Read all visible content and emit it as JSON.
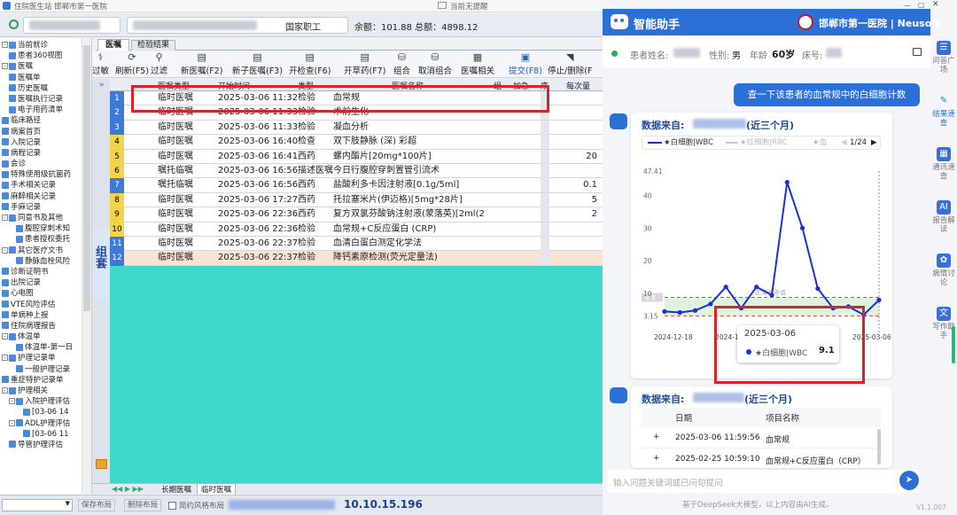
{
  "app": {
    "title": "住院医生站 邯郸市第一医院",
    "center_title": "当前无提醒"
  },
  "patient_bar": {
    "insurance": "国家职工",
    "balance": "余额：101.88 总额：4898.12"
  },
  "tabs": [
    {
      "label": "医嘱"
    },
    {
      "label": "检验结果"
    }
  ],
  "toolbar": [
    {
      "label": "过敏",
      "icon": "allergy"
    },
    {
      "label": "刷新(F5)",
      "icon": "refresh"
    },
    {
      "label": "过滤",
      "icon": "filter"
    },
    {
      "label": "新医嘱(F2)",
      "icon": "new"
    },
    {
      "label": "新子医嘱(F3)",
      "icon": "new-child"
    },
    {
      "label": "开检查(F6)",
      "icon": "exam"
    },
    {
      "label": "开草药(F7)",
      "icon": "herb"
    },
    {
      "label": "组合",
      "icon": "group"
    },
    {
      "label": "取消组合",
      "icon": "ungroup"
    },
    {
      "label": "医嘱相关",
      "icon": "related"
    },
    {
      "label": "提交(F8)",
      "icon": "save"
    },
    {
      "label": "停止/删除(F",
      "icon": "stop"
    }
  ],
  "tree": [
    {
      "label": "当前就诊",
      "level": 0,
      "expand": "-"
    },
    {
      "label": "患者360视图",
      "level": 1
    },
    {
      "label": "医嘱",
      "level": 0,
      "expand": "-"
    },
    {
      "label": "医嘱单",
      "level": 1
    },
    {
      "label": "历史医嘱",
      "level": 1
    },
    {
      "label": "医嘱执行记录",
      "level": 1
    },
    {
      "label": "电子用药清单",
      "level": 1
    },
    {
      "label": "临床路径",
      "level": 0
    },
    {
      "label": "病案首页",
      "level": 0
    },
    {
      "label": "入院记录",
      "level": 0
    },
    {
      "label": "病程记录",
      "level": 0
    },
    {
      "label": "会诊",
      "level": 0
    },
    {
      "label": "特殊使用级抗菌药",
      "level": 0
    },
    {
      "label": "手术相关记录",
      "level": 0
    },
    {
      "label": "麻醉相关记录",
      "level": 0
    },
    {
      "label": "手麻记录",
      "level": 0
    },
    {
      "label": "同意书及其他",
      "level": 0,
      "expand": "-"
    },
    {
      "label": "腹腔穿刺术知",
      "level": 2
    },
    {
      "label": "患者授权委托",
      "level": 2
    },
    {
      "label": "其它医疗文书",
      "level": 0,
      "expand": "-"
    },
    {
      "label": "静脉血栓风险",
      "level": 2
    },
    {
      "label": "诊断证明书",
      "level": 0
    },
    {
      "label": "出院记录",
      "level": 0
    },
    {
      "label": "心电图",
      "level": 0
    },
    {
      "label": "VTE风险评估",
      "level": 0
    },
    {
      "label": "单病种上报",
      "level": 0
    },
    {
      "label": "住院病理报告",
      "level": 0
    },
    {
      "label": "体温单",
      "level": 0,
      "expand": "-"
    },
    {
      "label": "体温单-第一日",
      "level": 2
    },
    {
      "label": "护理记录单",
      "level": 0,
      "expand": "-"
    },
    {
      "label": "一般护理记录",
      "level": 2
    },
    {
      "label": "重症特护记录单",
      "level": 0
    },
    {
      "label": "护理相关",
      "level": 0,
      "expand": "-"
    },
    {
      "label": "入院护理评估",
      "level": 1,
      "expand": "-"
    },
    {
      "label": "[03-06 14",
      "level": 3
    },
    {
      "label": "ADL护理评估",
      "level": 1,
      "expand": "-"
    },
    {
      "label": "[03-06 11",
      "level": 3
    },
    {
      "label": "导管护理评估",
      "level": 1
    }
  ],
  "grid": {
    "headers": [
      "医嘱类型",
      "开始时间",
      "类型",
      "医嘱名称",
      "组",
      "加急",
      "序",
      "每次量"
    ],
    "group_label": "组套",
    "rows": [
      {
        "no": "1",
        "type": "临时医嘱",
        "time": "2025-03-06 11:32",
        "cat": "检验",
        "name": "血常规",
        "dose": "",
        "urgent": false
      },
      {
        "no": "2",
        "type": "临时医嘱",
        "time": "2025-03-06 11:33",
        "cat": "检验",
        "name": "术前生化",
        "dose": "",
        "urgent": false
      },
      {
        "no": "3",
        "type": "临时医嘱",
        "time": "2025-03-06 11:33",
        "cat": "检验",
        "name": "凝血分析",
        "dose": "",
        "urgent": false
      },
      {
        "no": "4",
        "type": "临时医嘱",
        "time": "2025-03-06 16:40",
        "cat": "检查",
        "name": "双下肢静脉 (深) 彩超",
        "dose": "",
        "urgent": false
      },
      {
        "no": "5",
        "type": "临时医嘱",
        "time": "2025-03-06 16:41",
        "cat": "西药",
        "name": "螺内酯片[20mg*100片]",
        "dose": "20",
        "urgent": false
      },
      {
        "no": "6",
        "type": "嘱托临嘱",
        "time": "2025-03-06 16:56",
        "cat": "描述医嘱",
        "name": "今日行腹腔穿刺置管引流术",
        "dose": "",
        "urgent": false
      },
      {
        "no": "7",
        "type": "嘱托临嘱",
        "time": "2025-03-06 16:56",
        "cat": "西药",
        "name": "盐酸利多卡因注射液[0.1g/5ml]",
        "dose": "0.1",
        "urgent": false
      },
      {
        "no": "8",
        "type": "临时医嘱",
        "time": "2025-03-06 17:27",
        "cat": "西药",
        "name": "托拉塞米片(伊迈格)[5mg*28片]",
        "dose": "5",
        "urgent": false
      },
      {
        "no": "9",
        "type": "临时医嘱",
        "time": "2025-03-06 22:36",
        "cat": "西药",
        "name": "复方双氯芬酸钠注射液(蒙落英)[2ml(2",
        "dose": "2",
        "urgent": false
      },
      {
        "no": "10",
        "type": "临时医嘱",
        "time": "2025-03-06 22:36",
        "cat": "检验",
        "name": "血常规+C反应蛋白 (CRP)",
        "dose": "",
        "urgent": true
      },
      {
        "no": "11",
        "type": "临时医嘱",
        "time": "2025-03-06 22:37",
        "cat": "检验",
        "name": "血清白蛋白测定化学法",
        "dose": "",
        "urgent": true
      },
      {
        "no": "12",
        "type": "临时医嘱",
        "time": "2025-03-06 22:37",
        "cat": "检验",
        "name": "降钙素原检测(荧光定量法)",
        "dose": "",
        "urgent": true
      }
    ]
  },
  "bottom_tabs": [
    {
      "label": "长期医嘱"
    },
    {
      "label": "临时医嘱"
    }
  ],
  "status": {
    "save_layout": "保存布局",
    "delete_layout": "删除布局",
    "risk_layout": "简约风格布局",
    "ip": "10.10.15.196"
  },
  "assistant": {
    "title": "智能助手",
    "hospital": "邯郸市第一医院 | Neusoft",
    "patient_label": "患者姓名:",
    "gender_label": "性别:",
    "gender": "男",
    "age_label": "年龄",
    "age": "60岁",
    "bed_label": "床号:",
    "user_msg": "查一下该患者的血常规中的白细胞计数",
    "card1_prefix": "数据来自:",
    "card1_suffix": "(近三个月)",
    "legend": {
      "active": "★白细胞|WBC",
      "second": "★红细胞|RBC",
      "third": "★血",
      "page": "1/24"
    },
    "card2_prefix": "数据来自:",
    "card2_suffix": "(近三个月)",
    "table_headers": [
      "日期",
      "项目名称"
    ],
    "table_rows": [
      {
        "date": "2025-03-06 11:59:56",
        "item": "血常规"
      },
      {
        "date": "2025-02-25 10:59:10",
        "item": "血常规+C反应蛋白（CRP）"
      }
    ],
    "input_placeholder": "输入问题关键词或已问句提问",
    "footer": "基于DeepSeek大模型，以上内容由AI生成。",
    "version": "V1.1.007",
    "side_tabs": [
      {
        "label": "问答广场",
        "icon": "chat"
      },
      {
        "label": "结果速查",
        "icon": "pen"
      },
      {
        "label": "通讯速查",
        "icon": "calendar"
      },
      {
        "label": "报告解读",
        "icon": "ai"
      },
      {
        "label": "病情讨论",
        "icon": "brain"
      },
      {
        "label": "写作助手",
        "icon": "doc"
      }
    ]
  },
  "chart_data": {
    "type": "line",
    "series": [
      {
        "name": "★白细胞|WBC",
        "values": [
          4.5,
          4.2,
          4.8,
          6.8,
          12.0,
          5.5,
          12.0,
          9.5,
          44.0,
          30.0,
          11.5,
          5.5,
          6.0,
          3.5,
          8.0
        ]
      }
    ],
    "x": [
      "2024-12-18",
      "",
      "",
      "",
      "2024-12-30",
      "",
      "",
      "",
      "",
      "",
      "",
      "",
      "",
      "",
      "2025-03-06"
    ],
    "y_ticks": [
      "47.41",
      "40",
      "30",
      "20",
      "10",
      "3.15"
    ],
    "ylim": [
      0,
      47.41
    ],
    "ref_range": [
      3.15,
      8.8
    ],
    "ref_label": "正常参考值",
    "ref_high_label": "8.8",
    "tooltip": {
      "date": "2025-03-06",
      "label": "★白细胞|WBC",
      "value": "9.1"
    },
    "xlabel": "",
    "ylabel": ""
  }
}
